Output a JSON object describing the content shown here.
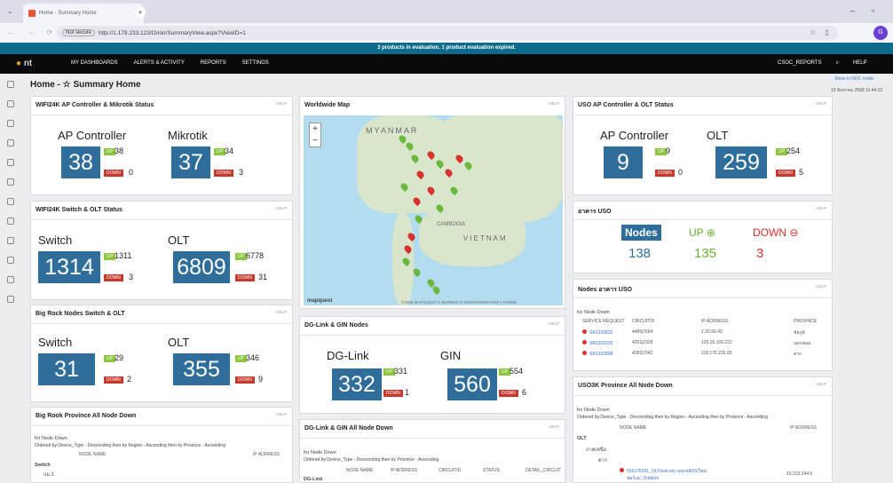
{
  "browser": {
    "tab_title": "Home - Summary Home",
    "url": "http://1.179.233.123/Orion/SummaryView.aspx?ViewID=1",
    "not_secure": "Not secure",
    "profile": "G"
  },
  "eval_banner": "3 products in evaluation. 1 product evaluation expired.",
  "nav": {
    "logo": "nt",
    "menus": [
      "MY DASHBOARDS",
      "ALERTS & ACTIVITY",
      "REPORTS",
      "SETTINGS"
    ],
    "user": "CSOC_REPORTS",
    "help": "HELP"
  },
  "breadcrumb": {
    "home": "Home -",
    "current": "Summary Home"
  },
  "noc": "Show in NOC mode",
  "date": "19 สิงหาคม 2568 11:44:12",
  "help": "HELP",
  "p1": {
    "title": "WIFI24K AP Controller & Mikrotik Status",
    "a": {
      "label": "AP Controller",
      "total": "38",
      "up": "38",
      "down": "0"
    },
    "b": {
      "label": "Mikrotik",
      "total": "37",
      "up": "34",
      "down": "3"
    }
  },
  "p2": {
    "title": "WIFI24K Switch & OLT Status",
    "a": {
      "label": "Switch",
      "total": "1314",
      "up": "1311",
      "down": "3"
    },
    "b": {
      "label": "OLT",
      "total": "6809",
      "up": "6778",
      "down": "31"
    }
  },
  "p3": {
    "title": "Big Rock Nodes Switch & OLT",
    "a": {
      "label": "Switch",
      "total": "31",
      "up": "29",
      "down": "2"
    },
    "b": {
      "label": "OLT",
      "total": "355",
      "up": "346",
      "down": "9"
    }
  },
  "p4": {
    "title": "Big Rook Province All Node Down",
    "for": "for Node Down",
    "ordered": "Ordered by:Device_Type - Descending then by Region - Ascending then by Province - Ascending",
    "col1": "NODE NAME",
    "col2": "IP ADDRESS",
    "group": "Switch",
    "sub": "กม.3"
  },
  "map": {
    "title": "Worldwide Map",
    "myanmar": "MYANMAR",
    "vietnam": "VIETNAM",
    "cambodia": "CAMBODIA",
    "attribution": "©2025 MAPQUEST © MAPBOX © OPENSTREETMAP | TERMS",
    "logo": "mapquest"
  },
  "dg": {
    "title": "DG-Link & GIN Nodes",
    "a": {
      "label": "DG-Link",
      "total": "332",
      "up": "331",
      "down": "1"
    },
    "b": {
      "label": "GIN",
      "total": "560",
      "up": "554",
      "down": "6"
    }
  },
  "dg2": {
    "title": "DG-Link & GIN All Node Down",
    "for": "for Node Down",
    "ordered": "Ordered by:Device_Type - Descending then by Province - Ascending",
    "cols": [
      "NODE NAME",
      "IP ADDRESS",
      "CIRCUITID",
      "STATUS",
      "DETAIL_CIRCUIT"
    ],
    "group": "DG-Link"
  },
  "uso": {
    "title": "USO AP Controller & OLT Status",
    "a": {
      "label": "AP Controller",
      "total": "9",
      "up": "9",
      "down": "0"
    },
    "b": {
      "label": "OLT",
      "total": "259",
      "up": "254",
      "down": "5"
    }
  },
  "usob": {
    "title": "อาคาร USO",
    "nodes_label": "Nodes",
    "up_label": "UP",
    "down_label": "DOWN",
    "nodes": "138",
    "up": "135",
    "down": "3"
  },
  "usonodes": {
    "title": "Nodes อาคาร USO",
    "for": "for Node Down",
    "cols": [
      "SERVICE REQUEST",
      "CIRCUITID",
      "IP ADDRESS",
      "PROVINCE"
    ],
    "rows": [
      [
        "SR1333832",
        "4485j7664",
        "1.20.90.43",
        "ชัยภูมิ"
      ],
      [
        "SR1333233",
        "4251j2328",
        "125.26.109.222",
        "นครพนม"
      ],
      [
        "SR1333868",
        "4282j7042",
        "118.175.226.93",
        "ตาก"
      ]
    ]
  },
  "uso3k": {
    "title": "USO3K Province All Node Down",
    "for": "for Node Down",
    "ordered": "Ordered by:Device_Type - Descending then by Region - Ascending then by Province - Ascending",
    "col1": "NODE NAME",
    "col2": "IP ADDRESS",
    "g1": "OLT",
    "g2": "ภาคเหนือ",
    "g3": "ตาก",
    "node": "555170191_OLT/sak-ecc-uso-kt601/ใหม่",
    "node2": "ฟอร์เด/_Outdoor",
    "ip": "10.223.244.5"
  }
}
